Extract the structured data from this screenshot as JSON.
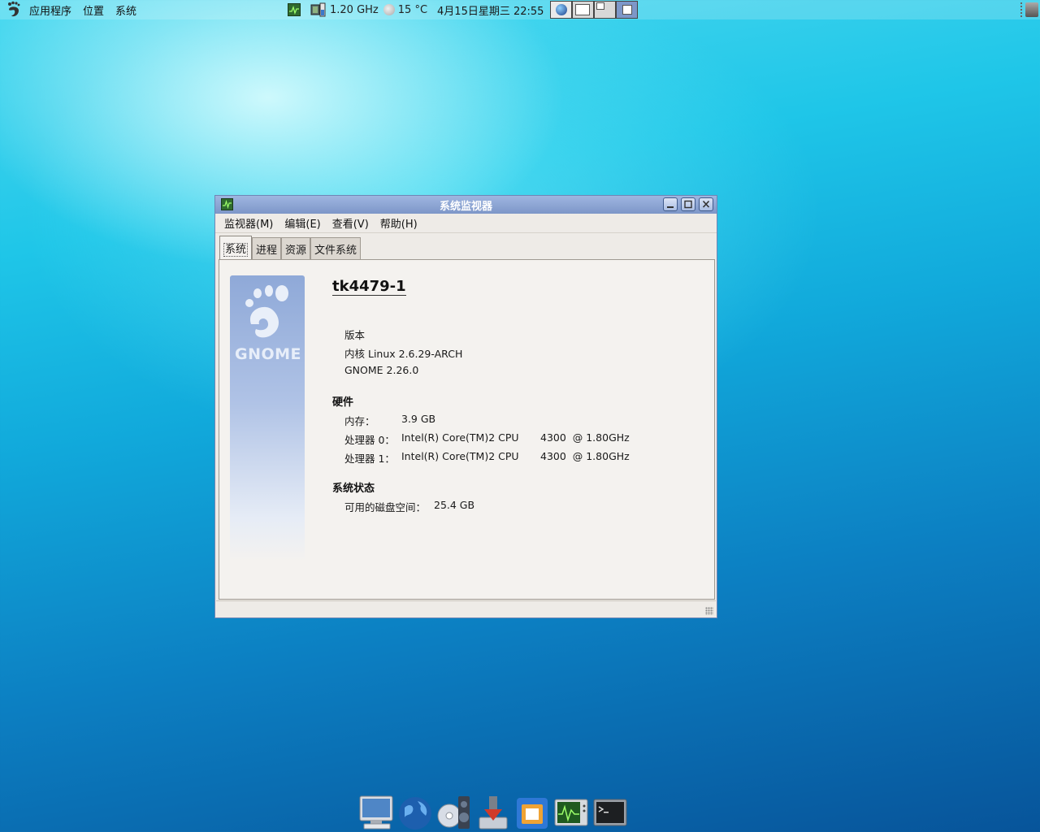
{
  "panel": {
    "menus": [
      "应用程序",
      "位置",
      "系统"
    ],
    "cpu_freq": "1.20 GHz",
    "temperature": "15 °C",
    "clock": "4月15日星期三 22:55"
  },
  "window": {
    "title": "系统监视器",
    "menus": [
      "监视器(M)",
      "编辑(E)",
      "查看(V)",
      "帮助(H)"
    ],
    "tabs": [
      "系统",
      "进程",
      "资源",
      "文件系统"
    ],
    "active_tab": "系统",
    "branding": "GNOME",
    "hostname": "tk4479-1",
    "version": {
      "heading": "版本",
      "kernel": "内核 Linux 2.6.29-ARCH",
      "gnome": "GNOME 2.26.0"
    },
    "hardware": {
      "heading": "硬件",
      "memory_label": "内存：",
      "memory_value": "3.9 GB",
      "cpu0_label": "处理器 0：",
      "cpu0_model": "Intel(R) Core(TM)2 CPU",
      "cpu0_speed": "4300  @ 1.80GHz",
      "cpu1_label": "处理器 1：",
      "cpu1_model": "Intel(R) Core(TM)2 CPU",
      "cpu1_speed": "4300  @ 1.80GHz"
    },
    "status": {
      "heading": "系统状态",
      "disk_label": "可用的磁盘空间：",
      "disk_value": "25.4 GB"
    }
  },
  "dock": [
    "computer-icon",
    "globe-icon",
    "media-icon",
    "download-icon",
    "virtualbox-icon",
    "system-monitor-icon",
    "terminal-icon"
  ],
  "colors": {
    "titlebar": "#8aa3d4",
    "panel_bg": "#eeebe7"
  }
}
